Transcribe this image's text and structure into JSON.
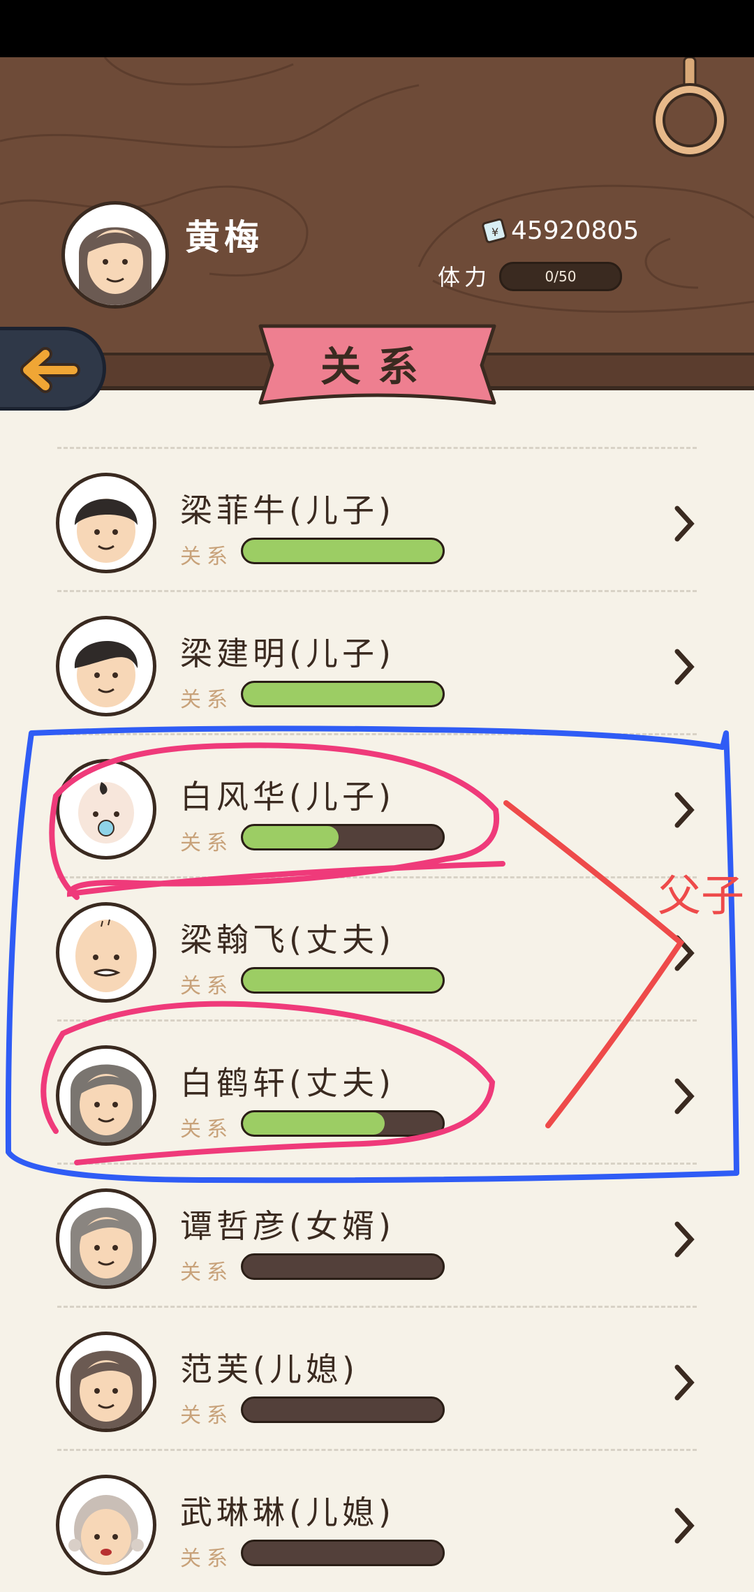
{
  "header": {
    "profile_name": "黄梅",
    "money": "45920805",
    "stamina_label": "体力",
    "stamina_value": "0/50",
    "title": "关系"
  },
  "relations_label": "关系",
  "people": [
    {
      "name": "梁菲牛(儿子)",
      "relationship": 1.0
    },
    {
      "name": "梁建明(儿子)",
      "relationship": 1.0
    },
    {
      "name": "白风华(儿子)",
      "relationship": 0.48
    },
    {
      "name": "梁翰飞(丈夫)",
      "relationship": 1.0
    },
    {
      "name": "白鹤轩(丈夫)",
      "relationship": 0.71
    },
    {
      "name": "谭哲彦(女婿)",
      "relationship": 0.0
    },
    {
      "name": "范芙(儿媳)",
      "relationship": 0.0
    },
    {
      "name": "武琳琳(儿媳)",
      "relationship": 0.0
    }
  ],
  "annotation": {
    "text": "父子"
  },
  "colors": {
    "wood": "#6e4b38",
    "bar_fill": "#9ccd64",
    "bar_empty": "#53403a",
    "ribbon": "#ee7f90",
    "annotation_red": "#ee4a4a",
    "annotation_blue": "#2f5cf5",
    "annotation_pink": "#ef3a7a"
  }
}
